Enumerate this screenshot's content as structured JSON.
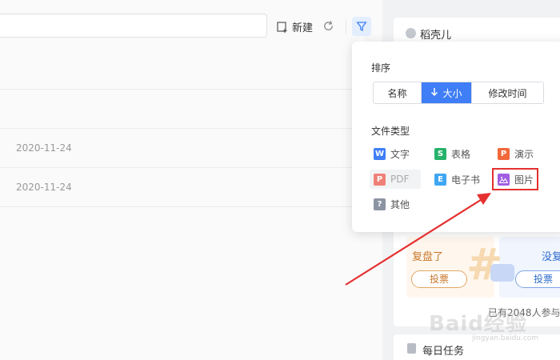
{
  "toolbar": {
    "new_label": "新建"
  },
  "file_rows": [
    {
      "date": ""
    },
    {
      "date": ""
    },
    {
      "date": "2020-11-24"
    },
    {
      "date": "2020-11-24"
    }
  ],
  "side": {
    "top_card_label": "稻壳儿",
    "vote": {
      "left_title": "复盘了",
      "right_title": "没复",
      "vote_label": "投票",
      "note": "已有2048人参与"
    },
    "task_label": "每日任务"
  },
  "popup": {
    "sort_label": "排序",
    "sort_options": [
      {
        "label": "名称",
        "active": false
      },
      {
        "label": "大小",
        "active": true,
        "icon": "arrow-down-icon"
      },
      {
        "label": "修改时间",
        "active": false
      }
    ],
    "type_label": "文件类型",
    "types": [
      {
        "label": "文字",
        "badge": "W",
        "color": "#3f7ef6"
      },
      {
        "label": "表格",
        "badge": "S",
        "color": "#27b26b"
      },
      {
        "label": "演示",
        "badge": "P",
        "color": "#f2683b"
      },
      {
        "label": "PDF",
        "badge": "P",
        "color": "#f05a4d"
      },
      {
        "label": "电子书",
        "badge": "E",
        "color": "#3fa6f2"
      },
      {
        "label": "图片",
        "badge": "",
        "color": "#a25ee3"
      },
      {
        "label": "其他",
        "badge": "?",
        "color": "#8c93a3"
      }
    ]
  },
  "watermark": {
    "text": "Baid经验",
    "url": "jingyan.baidu.com"
  }
}
